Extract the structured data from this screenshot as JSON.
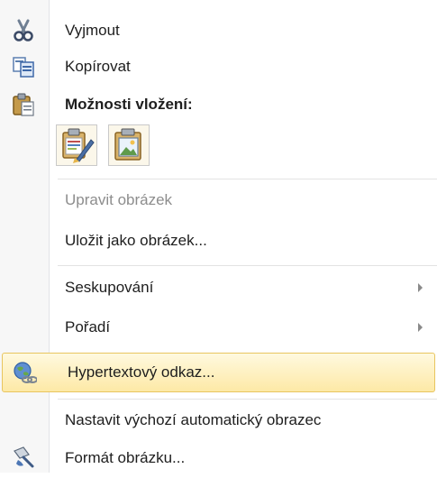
{
  "menu": {
    "items": [
      {
        "id": "cut",
        "label": "Vyjmout",
        "icon": "scissors-icon"
      },
      {
        "id": "copy",
        "label": "Kopírovat",
        "icon": "copy-icon"
      },
      {
        "id": "paste_header",
        "label": "Možnosti vložení:",
        "icon": "clipboard-icon"
      },
      {
        "id": "edit_image",
        "label": "Upravit obrázek",
        "disabled": true
      },
      {
        "id": "save_as_image",
        "label": "Uložit jako obrázek..."
      },
      {
        "id": "grouping",
        "label": "Seskupování",
        "submenu": true
      },
      {
        "id": "order",
        "label": "Pořadí",
        "submenu": true
      },
      {
        "id": "hyperlink",
        "label": "Hypertextový odkaz...",
        "icon": "globe-link-icon",
        "highlighted": true
      },
      {
        "id": "default_shape",
        "label": "Nastavit výchozí automatický obrazec"
      },
      {
        "id": "format_image",
        "label": "Formát obrázku...",
        "icon": "format-brush-icon"
      }
    ],
    "paste_options": [
      {
        "icon": "paste-keep-formatting-icon"
      },
      {
        "icon": "paste-picture-icon"
      }
    ]
  },
  "colors": {
    "highlight_top": "#fff9df",
    "highlight_bottom": "#fde9a6",
    "highlight_border": "#e8c55f",
    "disabled_text": "#8d8d8d"
  }
}
